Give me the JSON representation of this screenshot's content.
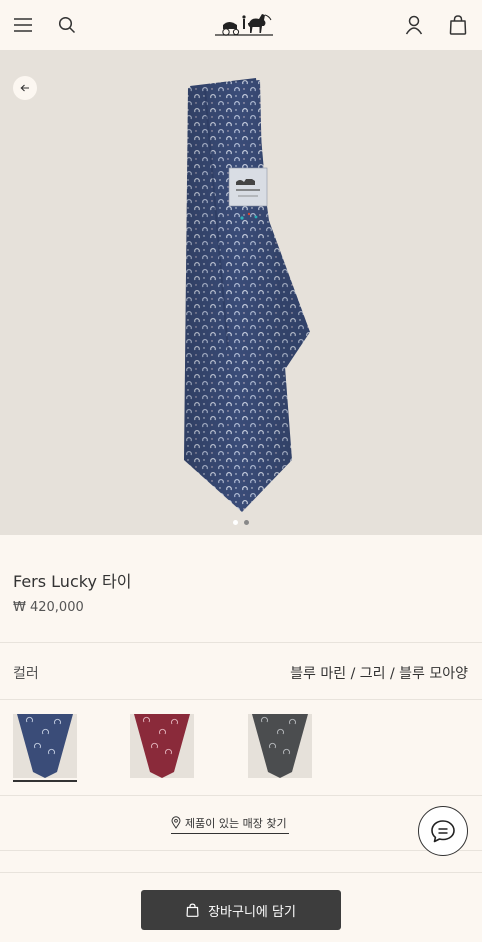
{
  "header": {
    "menu_icon": "hamburger-menu-icon",
    "search_icon": "search-icon",
    "logo": "HERMES PARIS",
    "account_icon": "user-icon",
    "bag_icon": "shopping-bag-icon"
  },
  "gallery": {
    "back_icon": "arrow-left-icon",
    "current_slide": 1,
    "total_slides": 2
  },
  "product": {
    "title": "Fers Lucky 타이",
    "price": "₩ 420,000"
  },
  "color": {
    "label": "컬러",
    "value": "블루 마린 / 그리 / 블루 모아양",
    "swatches": [
      {
        "name": "blue marine",
        "color": "#3a4c78",
        "selected": true
      },
      {
        "name": "red",
        "color": "#8a2a3a",
        "selected": false
      },
      {
        "name": "grey",
        "color": "#4b4d4f",
        "selected": false
      }
    ]
  },
  "store": {
    "label": "제품이 있는 매장 찾기",
    "icon": "location-pin-icon"
  },
  "chat": {
    "icon": "chat-icon"
  },
  "cart": {
    "label": "장바구니에 담기",
    "icon": "shopping-bag-icon"
  },
  "colors": {
    "background": "#fcf7f1",
    "hero_bg": "#e6e1da",
    "tie_navy": "#3a4c78",
    "button_dark": "#3d3d3d"
  }
}
